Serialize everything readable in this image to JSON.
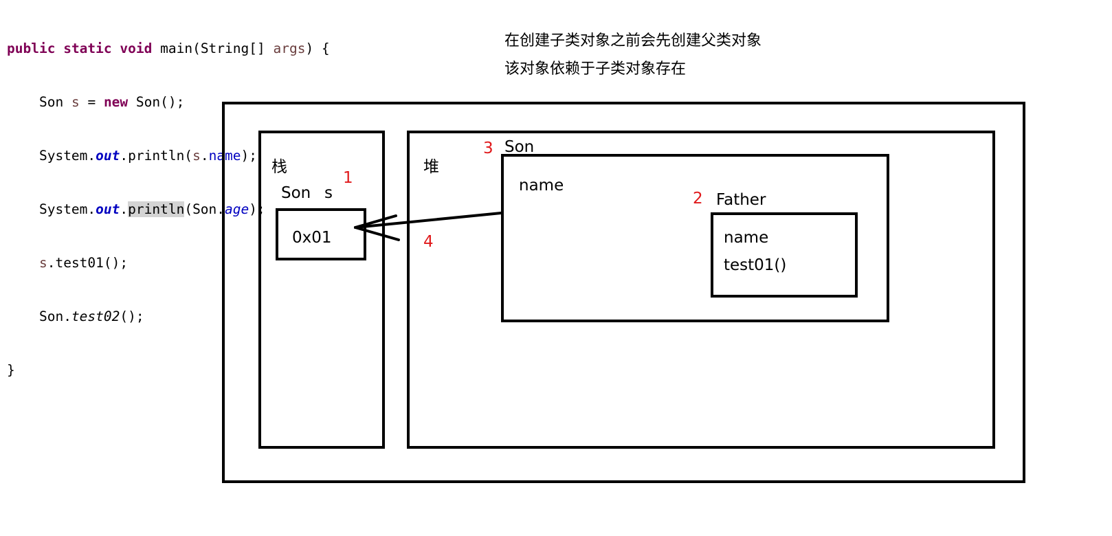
{
  "code": {
    "line1": {
      "kw1": "public",
      "kw2": "static",
      "kw3": "void",
      "rest_a": " main(String[] ",
      "param": "args",
      "rest_b": ") {"
    },
    "line2": {
      "type": "Son",
      "var": "s",
      "eq": " = ",
      "kw": "new",
      "rest": " Son();"
    },
    "line3": {
      "a": "System.",
      "field": "out",
      "b": ".println(",
      "var": "s",
      "dot": ".",
      "member": "name",
      "c": ");"
    },
    "line4": {
      "a": "System.",
      "field": "out",
      "dot": ".",
      "method": "println",
      "b": "(Son.",
      "member": "age",
      "c": ");"
    },
    "line5": {
      "var": "s",
      "rest": ".test01();"
    },
    "line6": {
      "a": "Son.",
      "method": "test02",
      "b": "();"
    },
    "line7": {
      "brace": "}"
    }
  },
  "notes": {
    "line1": "在创建子类对象之前会先创建父类对象",
    "line2": "该对象依赖于子类对象存在"
  },
  "diagram": {
    "stack_label": "栈",
    "heap_label": "堆",
    "stack_var_type": "Son",
    "stack_var_name": "s",
    "address": "0x01",
    "son_title": "Son",
    "son_field": "name",
    "father_title": "Father",
    "father_field": "name",
    "father_method": "test01()",
    "step1": "1",
    "step2": "2",
    "step3": "3",
    "step4": "4"
  },
  "colors": {
    "keyword": "#7f0055",
    "field": "#0000c0",
    "local_var": "#6a3e3e",
    "step_number": "#e0191b",
    "highlight": "#d4d4d4"
  }
}
